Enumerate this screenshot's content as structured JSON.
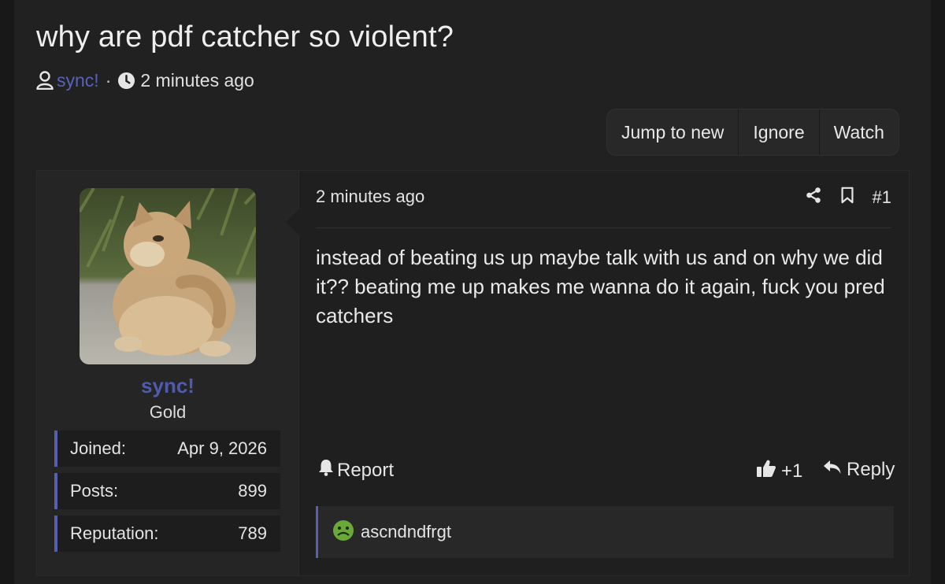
{
  "thread": {
    "title": "why are pdf catcher so violent?",
    "author": "sync!",
    "separator": "·",
    "time": "2 minutes ago"
  },
  "actions": {
    "jump_to_new": "Jump to new",
    "ignore": "Ignore",
    "watch": "Watch"
  },
  "user": {
    "name": "sync!",
    "title": "Gold",
    "stats": [
      {
        "label": "Joined:",
        "value": "Apr 9, 2026"
      },
      {
        "label": "Posts:",
        "value": "899"
      },
      {
        "label": "Reputation:",
        "value": "789"
      }
    ]
  },
  "post": {
    "time": "2 minutes ago",
    "number": "#1",
    "body": "instead of beating us up maybe talk with us and on why we did it?? beating me up makes me wanna do it again, fuck you pred catchers",
    "report_label": "Report",
    "reaction_count": "+1",
    "reply_label": "Reply",
    "reactions_by": "ascndndfrgt"
  },
  "colors": {
    "accent": "#5660b0",
    "link": "#5961b8",
    "reaction_emoji": "#6aa83a"
  }
}
